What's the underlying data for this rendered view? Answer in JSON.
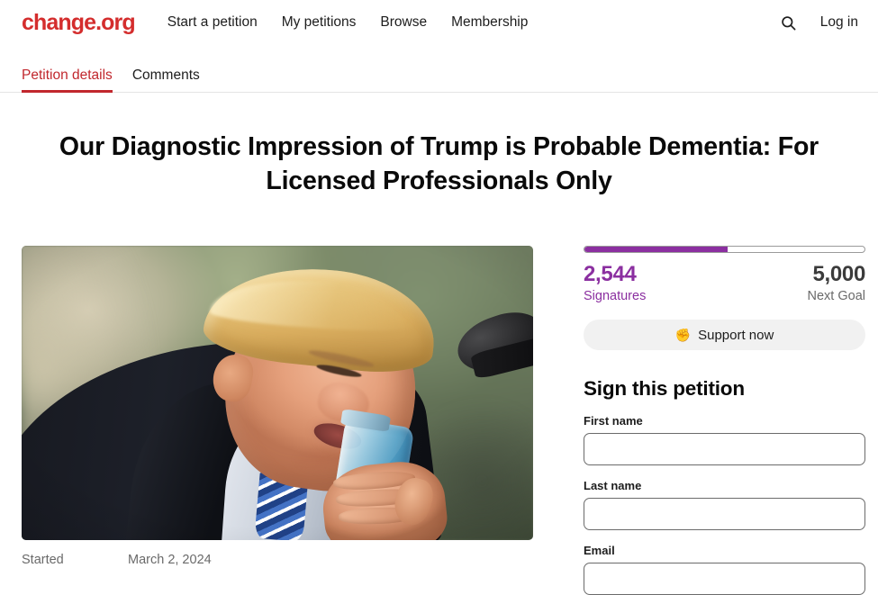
{
  "header": {
    "logo": "change.org",
    "nav": [
      {
        "label": "Start a petition"
      },
      {
        "label": "My petitions"
      },
      {
        "label": "Browse"
      },
      {
        "label": "Membership"
      }
    ],
    "search_icon": "search-icon",
    "login_label": "Log in"
  },
  "tabs": [
    {
      "label": "Petition details",
      "active": true
    },
    {
      "label": "Comments",
      "active": false
    }
  ],
  "petition": {
    "title": "Our Diagnostic Impression of Trump is Probable Dementia: For Licensed Professionals Only",
    "started_label": "Started",
    "started_date": "March 2, 2024"
  },
  "progress": {
    "percent": 51,
    "signature_count": "2,544",
    "signature_label": "Signatures",
    "goal_count": "5,000",
    "goal_label": "Next Goal",
    "bar_color": "#8b2fa0",
    "accent_color": "#8b2fa0"
  },
  "support_button": {
    "label": "Support now",
    "icon": "raised-fist-icon",
    "icon_glyph": "✊"
  },
  "sign_form": {
    "heading": "Sign this petition",
    "fields": [
      {
        "label": "First name",
        "value": "",
        "placeholder": ""
      },
      {
        "label": "Last name",
        "value": "",
        "placeholder": ""
      },
      {
        "label": "Email",
        "value": "",
        "placeholder": ""
      }
    ]
  },
  "theme": {
    "brand_red": "#d42d2d",
    "tab_active_red": "#c1272d",
    "purple": "#8b2fa0",
    "text_dark": "#1d1d1d",
    "text_muted": "#6a6a6a"
  }
}
